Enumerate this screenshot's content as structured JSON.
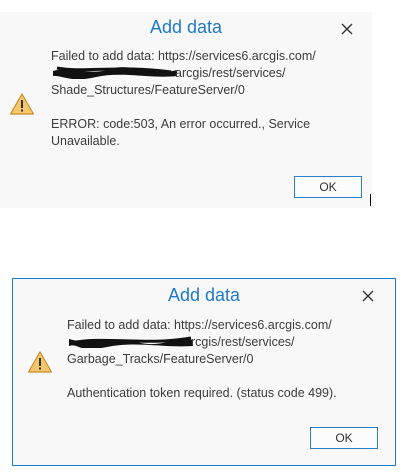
{
  "dialogs": [
    {
      "title": "Add data",
      "message_lines": [
        "Failed to add data: https://services6.arcgis.com/",
        "arcgis/rest/services/",
        "Shade_Structures/FeatureServer/0",
        "ERROR: code:503, An error occurred., Service",
        "Unavailable."
      ],
      "ok_label": "OK",
      "icons": {
        "warning": "warning-icon",
        "close": "close-icon"
      }
    },
    {
      "title": "Add data",
      "message_lines": [
        "Failed to add data: https://services6.arcgis.com/",
        "rcgis/rest/services/",
        "Garbage_Tracks/FeatureServer/0",
        "Authentication token required. (status code 499)."
      ],
      "ok_label": "OK",
      "icons": {
        "warning": "warning-icon",
        "close": "close-icon"
      }
    }
  ],
  "colors": {
    "title": "#1f7ac6",
    "border": "#1f7ac6",
    "warning_fill": "#f5c86e",
    "warning_stroke": "#c98d2a",
    "redaction": "#111111"
  }
}
